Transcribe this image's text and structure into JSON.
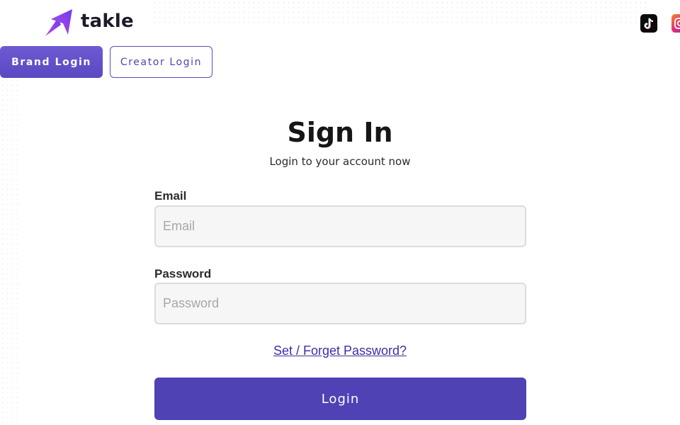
{
  "brand": {
    "name": "takle",
    "logo_icon": "paper-plane-arrow-logo",
    "logo_colors": [
      "#6b3cf0",
      "#c04bd8"
    ]
  },
  "social": [
    {
      "name": "tiktok",
      "icon": "tiktok-icon",
      "glyph": "♪",
      "color": "#0b0b0b"
    },
    {
      "name": "instagram",
      "icon": "instagram-icon",
      "glyph": "",
      "color": "#dd2a7b"
    }
  ],
  "tabs": [
    {
      "label": "Brand Login",
      "active": true
    },
    {
      "label": "Creator Login",
      "active": false
    }
  ],
  "form": {
    "title": "Sign In",
    "subtitle": "Login to your account now",
    "email": {
      "label": "Email",
      "placeholder": "Email",
      "value": ""
    },
    "password": {
      "label": "Password",
      "placeholder": "Password",
      "value": ""
    },
    "forgot_link": "Set / Forget Password?",
    "submit_label": "Login"
  },
  "colors": {
    "accent": "#4f42b5",
    "tab_active": "#6351c9",
    "link": "#3d2fa4"
  }
}
